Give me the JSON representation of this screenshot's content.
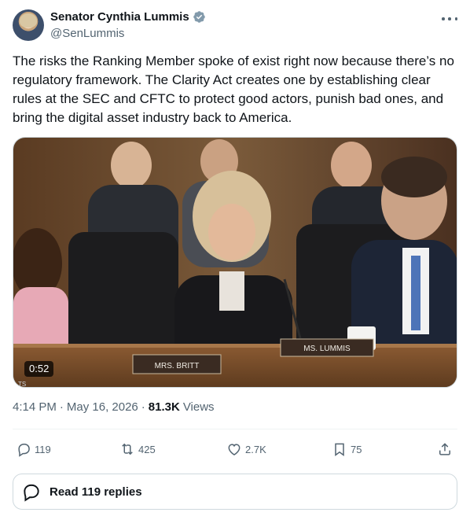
{
  "author": {
    "name": "Senator Cynthia Lummis",
    "handle": "@SenLummis"
  },
  "tweet": {
    "text": "The risks the Ranking Member spoke of exist right now because there’s no regulatory framework. The Clarity Act creates one by establishing clear rules at the SEC and CFTC to protect good actors, punish bad ones, and bring the digital asset industry back to America."
  },
  "media": {
    "duration": "0:52",
    "nameplate_left": "MRS. BRITT",
    "nameplate_center": "MS. LUMMIS",
    "corner_text": "TS"
  },
  "meta": {
    "time": "4:14 PM",
    "sep1": "·",
    "date": "May 16, 2026",
    "sep2": "·",
    "views_count": "81.3K",
    "views_label": "Views"
  },
  "actions": {
    "replies": "119",
    "reposts": "425",
    "likes": "2.7K",
    "bookmarks": "75"
  },
  "read_replies": {
    "label": "Read 119 replies"
  },
  "colors": {
    "verified": "#829aab",
    "secondary_text": "#536471",
    "border": "#cfd9de"
  }
}
